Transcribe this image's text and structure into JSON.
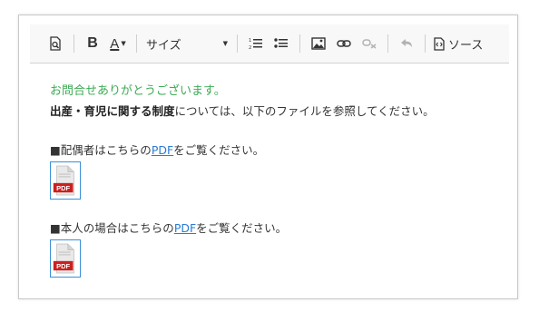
{
  "toolbar": {
    "size_label": "サイズ",
    "source_label": "ソース",
    "bold_label": "B",
    "color_label": "A",
    "icons": [
      "preview-icon",
      "bold-icon",
      "text-color-icon",
      "numbered-list-icon",
      "bullet-list-icon",
      "image-icon",
      "link-icon",
      "unlink-icon",
      "undo-icon",
      "source-icon"
    ]
  },
  "content": {
    "greeting": "お問合せありがとうございます。",
    "intro_bold": "出産・育児に関する制度",
    "intro_rest": "については、以下のファイルを参照してください。",
    "items": [
      {
        "prefix": "■配偶者はこちらの",
        "link": "PDF",
        "suffix": "をご覧ください。",
        "icon_label": "PDF"
      },
      {
        "prefix": "■本人の場合はこちらの",
        "link": "PDF",
        "suffix": "をご覧ください。",
        "icon_label": "PDF"
      }
    ]
  },
  "colors": {
    "greeting": "#3cab54",
    "link": "#2b7bd6",
    "pdf_red": "#cc1f1f",
    "icon_border": "#3b8fd9"
  }
}
